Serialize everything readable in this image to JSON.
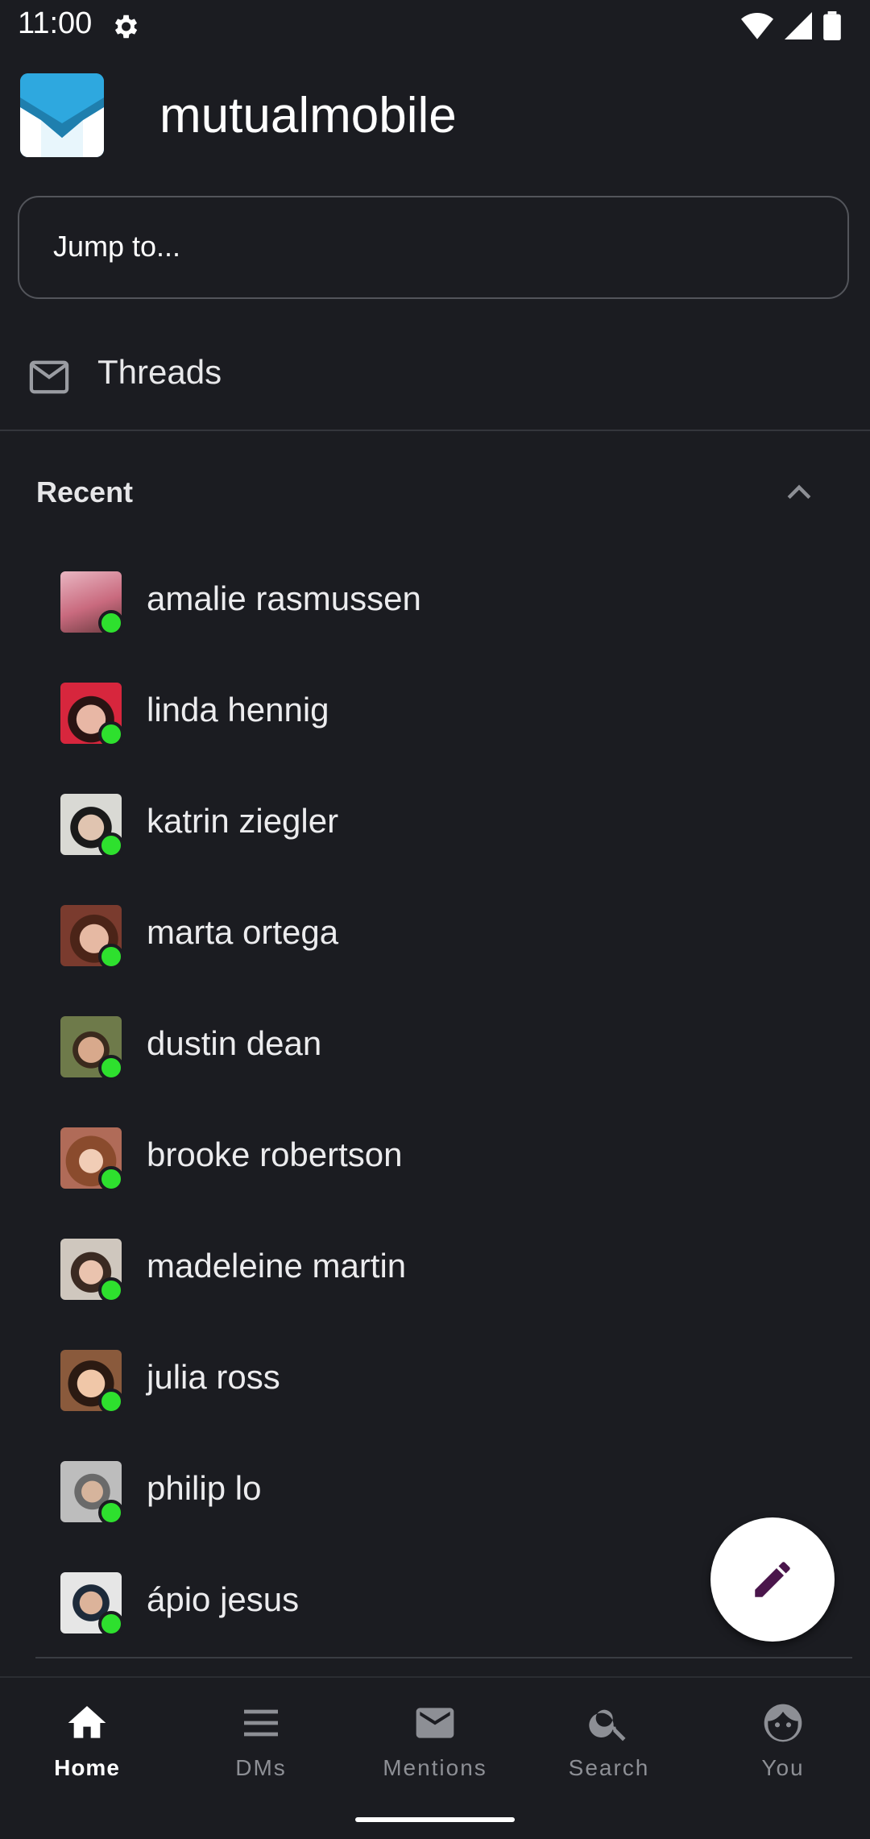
{
  "status_bar": {
    "time": "11:00"
  },
  "workspace": {
    "name": "mutualmobile"
  },
  "jump_to": {
    "placeholder": "Jump to..."
  },
  "threads": {
    "label": "Threads"
  },
  "recent": {
    "title": "Recent",
    "items": [
      {
        "name": "amalie rasmussen",
        "avatar_color": "#c96a7e"
      },
      {
        "name": "linda hennig",
        "avatar_color": "#d7263d"
      },
      {
        "name": "katrin ziegler",
        "avatar_color": "#d9d9d4"
      },
      {
        "name": "marta ortega",
        "avatar_color": "#7a3b2e"
      },
      {
        "name": "dustin dean",
        "avatar_color": "#6e7a4a"
      },
      {
        "name": "brooke robertson",
        "avatar_color": "#b06b58"
      },
      {
        "name": "madeleine martin",
        "avatar_color": "#cfc7be"
      },
      {
        "name": "julia ross",
        "avatar_color": "#8a5a3c"
      },
      {
        "name": "philip lo",
        "avatar_color": "#a0a0a0"
      },
      {
        "name": "ápio jesus",
        "avatar_color": "#e6e6e6"
      }
    ]
  },
  "nav": {
    "home": "Home",
    "dms": "DMs",
    "mentions": "Mentions",
    "search": "Search",
    "you": "You"
  },
  "colors": {
    "background": "#1b1c21",
    "presence": "#2ee02e",
    "logo": "#2ea8df",
    "fab_icon": "#4a154b"
  }
}
